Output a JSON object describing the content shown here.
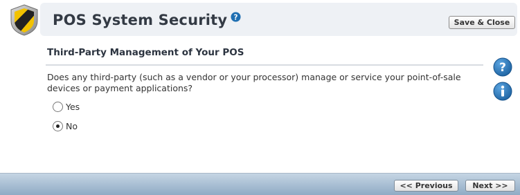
{
  "header": {
    "title": "POS System Security",
    "logo_icon": "shield-icon",
    "help_icon": "help-icon",
    "save_label": "Save & Close"
  },
  "section": {
    "title": "Third-Party Management of Your POS",
    "question": "Does any third-party (such as a vendor or your processor) manage or service your point-of-sale devices or payment applications?",
    "options": [
      {
        "label": "Yes",
        "selected": false
      },
      {
        "label": "No",
        "selected": true
      }
    ]
  },
  "side_icons": [
    "help-icon",
    "info-icon"
  ],
  "footer": {
    "previous_label": "<< Previous",
    "next_label": "Next >>"
  },
  "colors": {
    "header_band": "#eef1f5",
    "footer_top": "#c5d5e4",
    "footer_bottom": "#8fabc5",
    "icon_blue": "#1f6fb2"
  }
}
